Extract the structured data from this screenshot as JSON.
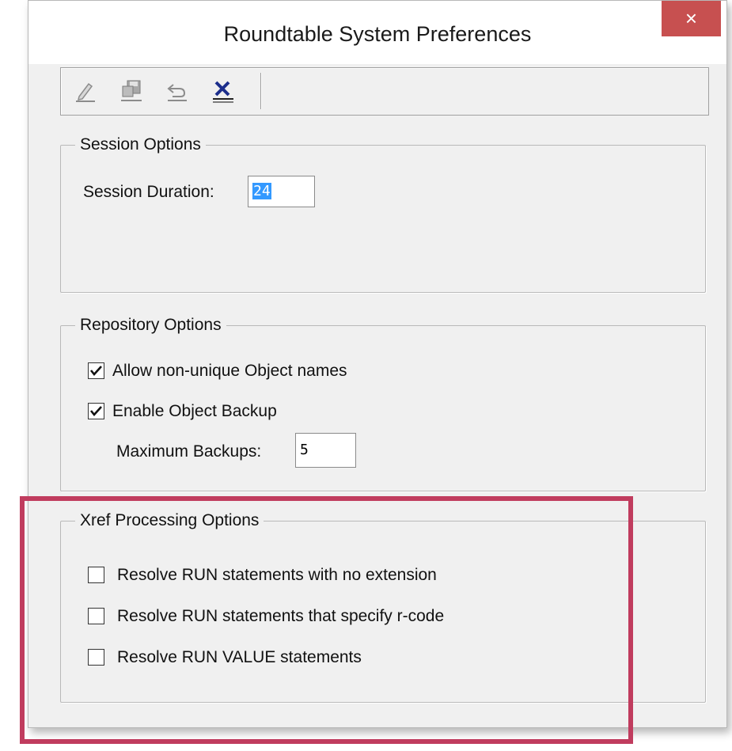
{
  "window": {
    "title": "Roundtable System Preferences",
    "close_label": "×"
  },
  "toolbar": {
    "items": [
      {
        "icon": "edit-icon"
      },
      {
        "icon": "save-icon"
      },
      {
        "icon": "undo-icon"
      },
      {
        "icon": "cancel-icon"
      }
    ]
  },
  "session": {
    "legend": "Session Options",
    "duration_label": "Session Duration:",
    "duration_value": "24"
  },
  "repository": {
    "legend": "Repository Options",
    "allow_nonunique_label": "Allow non-unique Object names",
    "allow_nonunique_checked": true,
    "enable_backup_label": "Enable Object Backup",
    "enable_backup_checked": true,
    "max_backups_label": "Maximum Backups:",
    "max_backups_value": "5"
  },
  "xref": {
    "legend": "Xref Processing Options",
    "options": [
      {
        "label": "Resolve RUN statements with no extension",
        "checked": false
      },
      {
        "label": "Resolve RUN statements that specify r-code",
        "checked": false
      },
      {
        "label": "Resolve RUN VALUE statements",
        "checked": false
      }
    ]
  },
  "colors": {
    "highlight": "#c03c5e",
    "selection": "#3399ff",
    "close": "#c75050"
  }
}
